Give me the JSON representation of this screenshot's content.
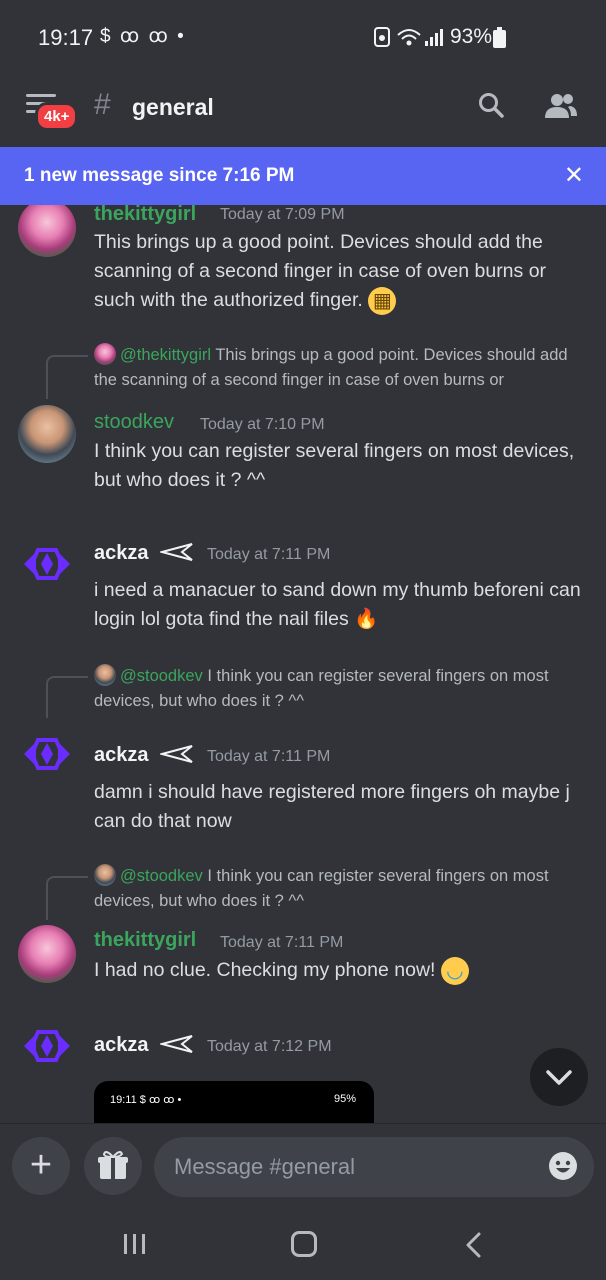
{
  "status_bar": {
    "time": "19:17",
    "left_icons": "$ ꝏ ꝏ •",
    "battery": "93%"
  },
  "header": {
    "badge": "4k+",
    "channel": "general"
  },
  "banner": {
    "text": "1 new message since 7:16 PM",
    "close": "✕"
  },
  "messages": [
    {
      "username": "thekittygirl",
      "timestamp": "Today at 7:09 PM",
      "text": "This brings up a good point. Devices should add the scanning of a second finger in case of oven burns or such with the authorized finger."
    },
    {
      "reply": {
        "mention": "@thekittygirl",
        "text": "This brings up a good point. Devices should add the scanning of a second finger in case of oven burns or"
      },
      "username": "stoodkev",
      "timestamp": "Today at 7:10 PM",
      "text": "I think you can register several fingers on most devices, but who does it ? ^^"
    },
    {
      "username": "ackza",
      "timestamp": "Today at 7:11 PM",
      "text": "i need a manacuer to sand down my thumb beforeni can login lol gota find the nail files"
    },
    {
      "reply": {
        "mention": "@stoodkev",
        "text": "I think you can register several fingers on most devices, but who does it ? ^^"
      },
      "username": "ackza",
      "timestamp": "Today at 7:11 PM",
      "text": "damn i should have registered more fingers oh maybe j can do that now"
    },
    {
      "reply": {
        "mention": "@stoodkev",
        "text": "I think you can register several fingers on most devices, but who does it ? ^^"
      },
      "username": "thekittygirl",
      "timestamp": "Today at 7:11 PM",
      "text": "I had no clue. Checking my phone now!"
    },
    {
      "username": "ackza",
      "timestamp": "Today at 7:12 PM",
      "embed": {
        "time": "19:11 $ ꝏ ꝏ •",
        "battery": "95%"
      }
    }
  ],
  "composer": {
    "placeholder": "Message #general"
  }
}
